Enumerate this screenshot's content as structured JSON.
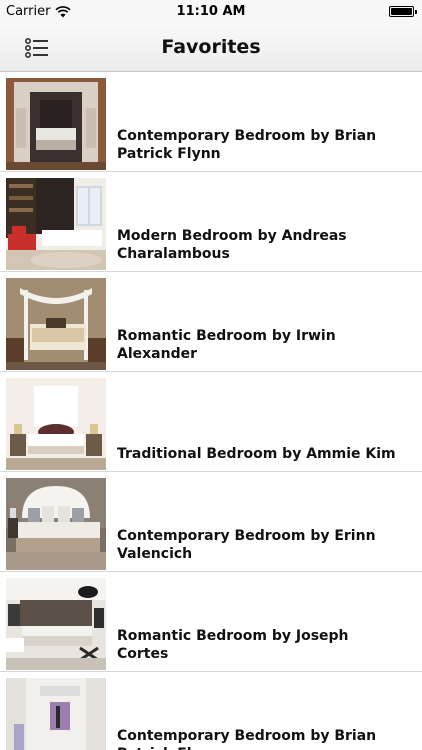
{
  "status_bar": {
    "carrier": "Carrier",
    "time": "11:10 AM",
    "battery_level": 1.0
  },
  "nav": {
    "title": "Favorites",
    "menu_icon": "list-icon"
  },
  "favorites": [
    {
      "title": "Contemporary Bedroom by Brian Patrick Flynn"
    },
    {
      "title": "Modern Bedroom by Andreas Charalambous"
    },
    {
      "title": "Romantic Bedroom by Irwin Alexander"
    },
    {
      "title": "Traditional Bedroom by Ammie Kim"
    },
    {
      "title": "Contemporary Bedroom by Erinn Valencich"
    },
    {
      "title": "Romantic Bedroom by Joseph Cortes"
    },
    {
      "title": "Contemporary Bedroom by Brian Patrick Flynn"
    }
  ],
  "colors": {
    "nav_background": "#f2f2f2",
    "separator": "#d8d8d8",
    "text": "#111111"
  }
}
